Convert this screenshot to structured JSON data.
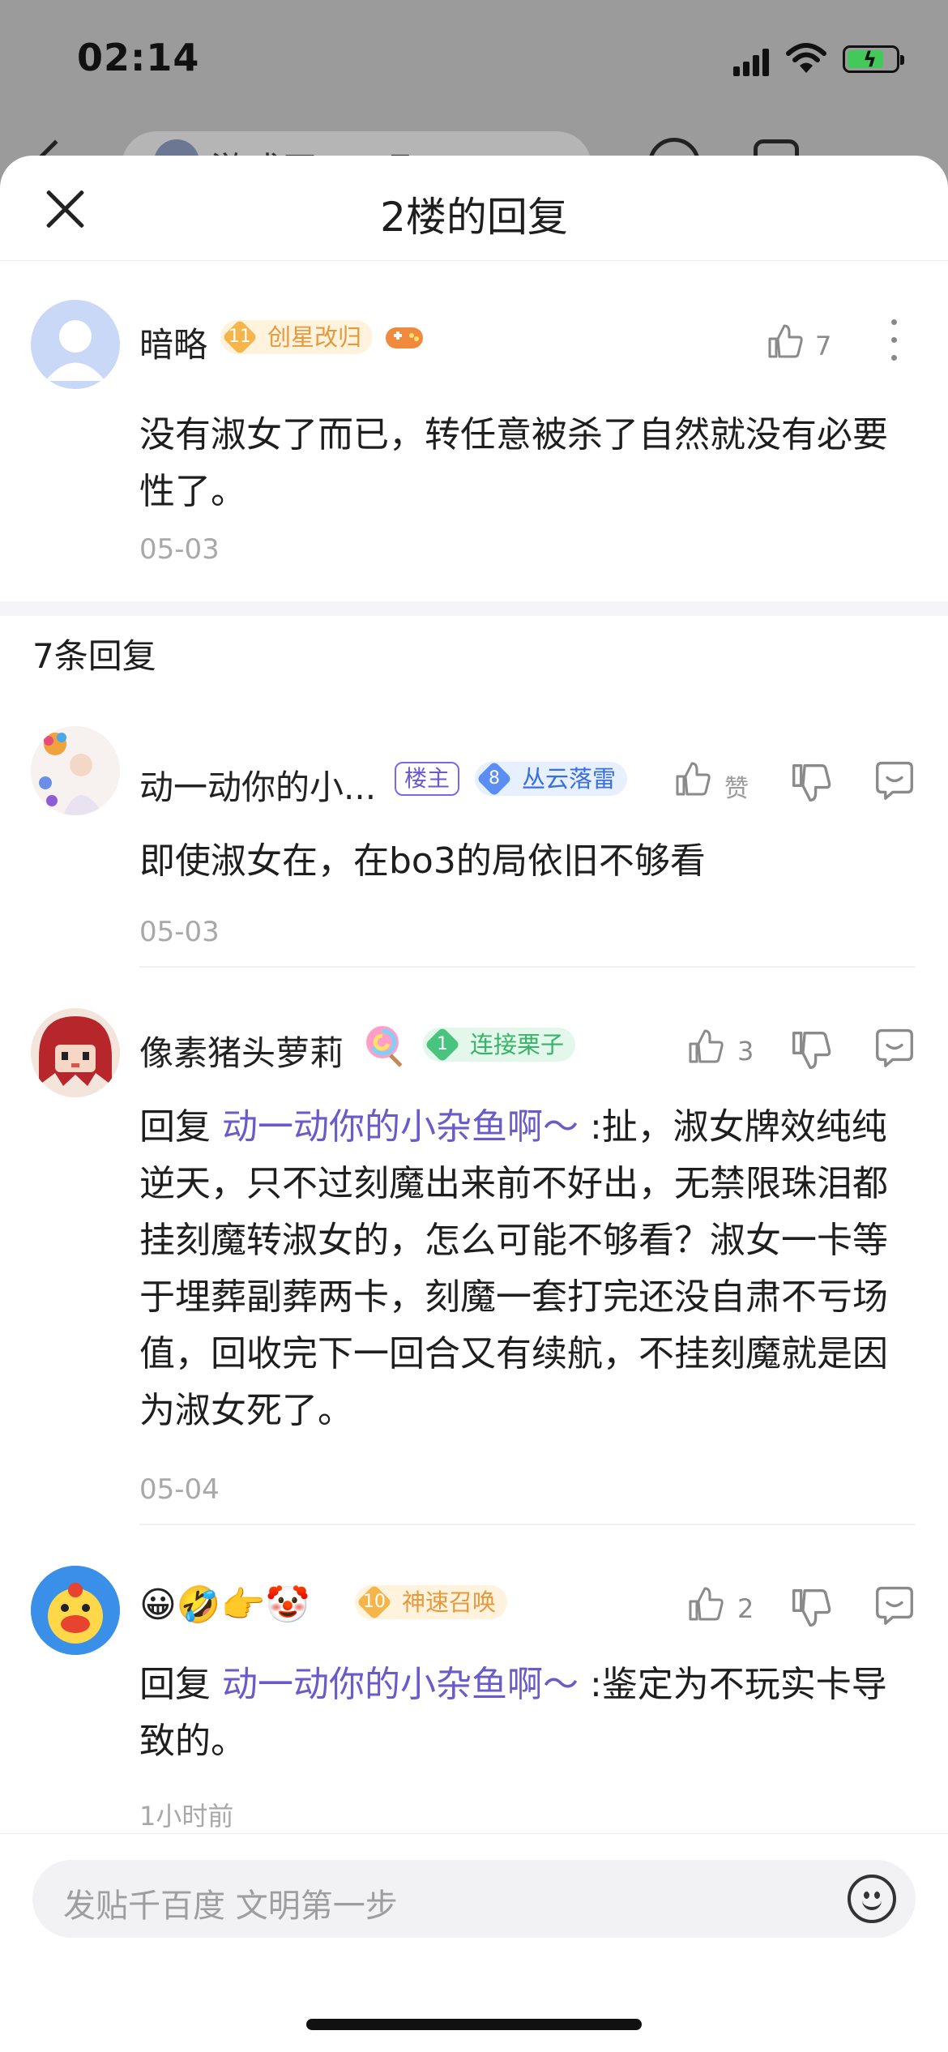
{
  "status_bar": {
    "time": "02:14"
  },
  "background_page": {
    "search_text": "游戏王 … 吧"
  },
  "sheet": {
    "title": "2楼的回复",
    "close": "close"
  },
  "main_comment": {
    "username": "暗略",
    "level": "11",
    "title": "创星改归",
    "content": "没有淑女了而已，转任意被杀了自然就没有必要性了。",
    "date": "05-03",
    "likes": "7"
  },
  "reply_count_label": "7条回复",
  "replies": [
    {
      "username": "动一动你的小...",
      "owner_tag": "楼主",
      "level": "8",
      "title": "丛云落雷",
      "content": "即使淑女在，在bo3的局依旧不够看",
      "date": "05-03",
      "likes": "赞"
    },
    {
      "username": "像素猪头萝莉",
      "level": "1",
      "title": "连接栗子",
      "reply_prefix": "回复 ",
      "mention": "动一动你的小杂鱼啊～",
      "content": " :扯，淑女牌效纯纯逆天，只不过刻魔出来前不好出，无禁限珠泪都挂刻魔转淑女的，怎么可能不够看？淑女一卡等于埋葬副葬两卡，刻魔一套打完还没自肃不亏场值，回收完下一回合又有续航，不挂刻魔就是因为淑女死了。",
      "date": "05-04",
      "likes": "3"
    },
    {
      "username": "😀🤣👉🤡",
      "level": "10",
      "title": "神速召唤",
      "reply_prefix": "回复 ",
      "mention": "动一动你的小杂鱼啊～",
      "content": " :鉴定为不玩实卡导致的。",
      "date": "1小时前",
      "likes": "2"
    }
  ],
  "input": {
    "placeholder": "发贴千百度 文明第一步"
  },
  "colors": {
    "mention": "#6a5cc8",
    "owner_tag": "#6a5acd",
    "date": "#a8a8a8"
  }
}
